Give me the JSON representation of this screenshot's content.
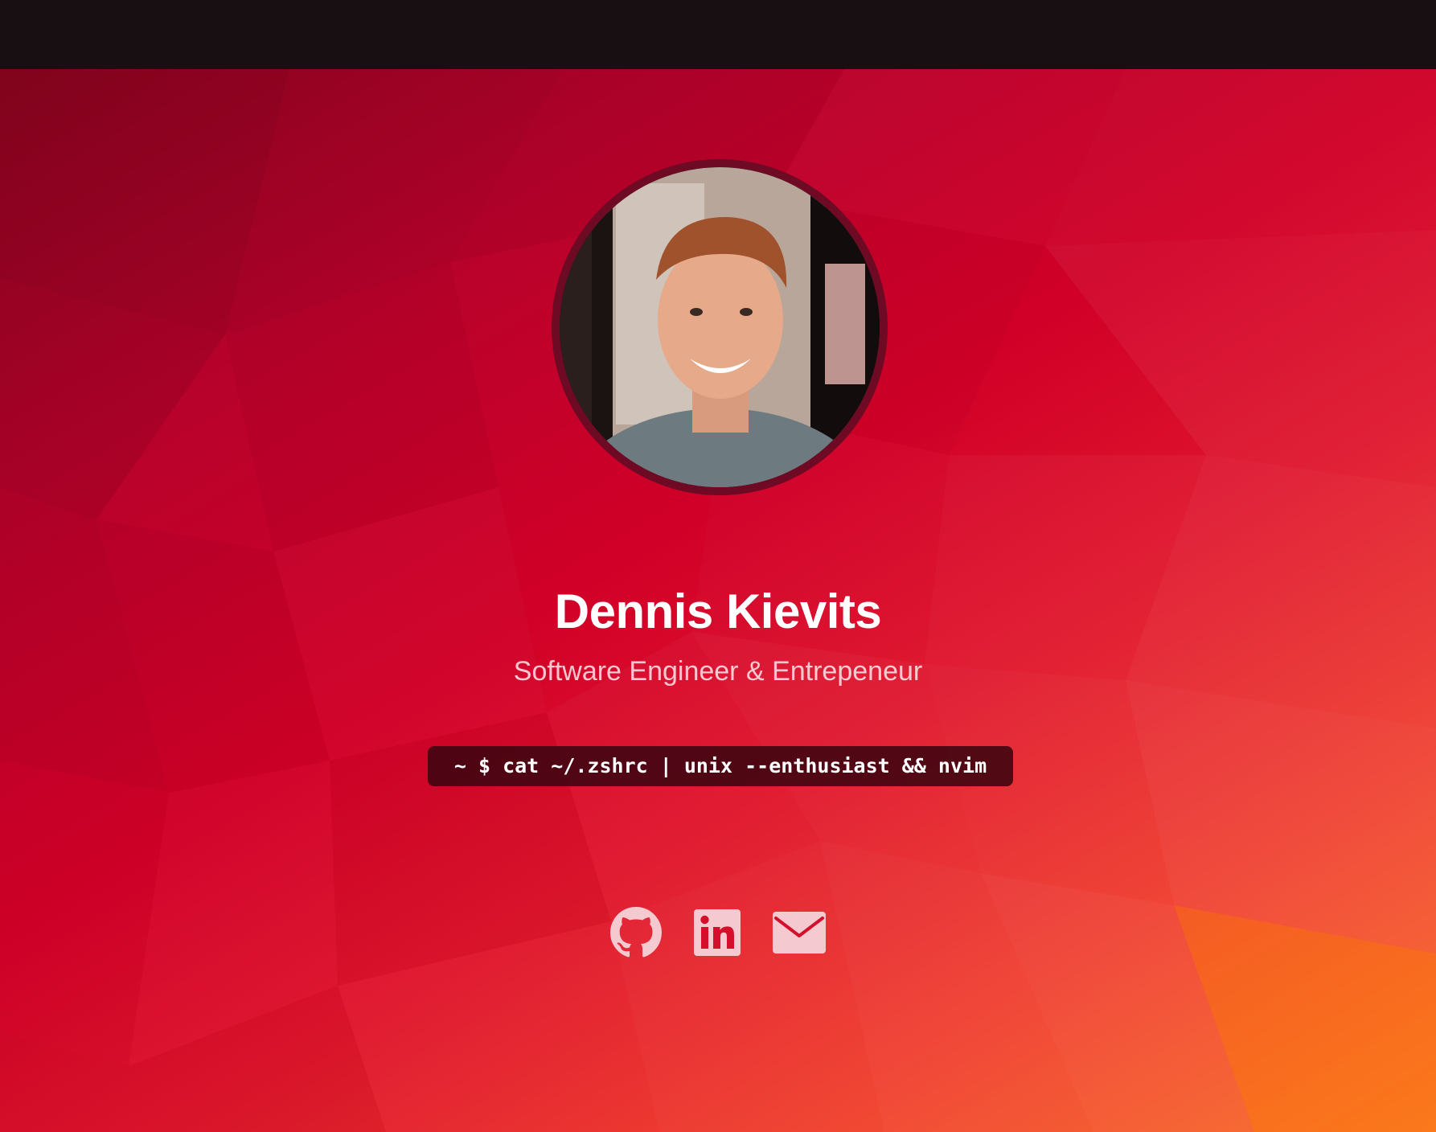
{
  "profile": {
    "name": "Dennis Kievits",
    "tagline": "Software Engineer & Entrepeneur",
    "command": "~ $ cat ~/.zshrc | unix --enthusiast && nvim"
  },
  "social": [
    {
      "icon": "github-icon"
    },
    {
      "icon": "linkedin-icon"
    },
    {
      "icon": "mail-icon"
    }
  ],
  "colors": {
    "background_dark": "#170f12",
    "hero_red": "#d10028",
    "hero_orange": "#f9671c",
    "avatar_border": "#6e0a24",
    "terminal_bg": "#3c0410",
    "icon_color": "#f4c9d0"
  }
}
